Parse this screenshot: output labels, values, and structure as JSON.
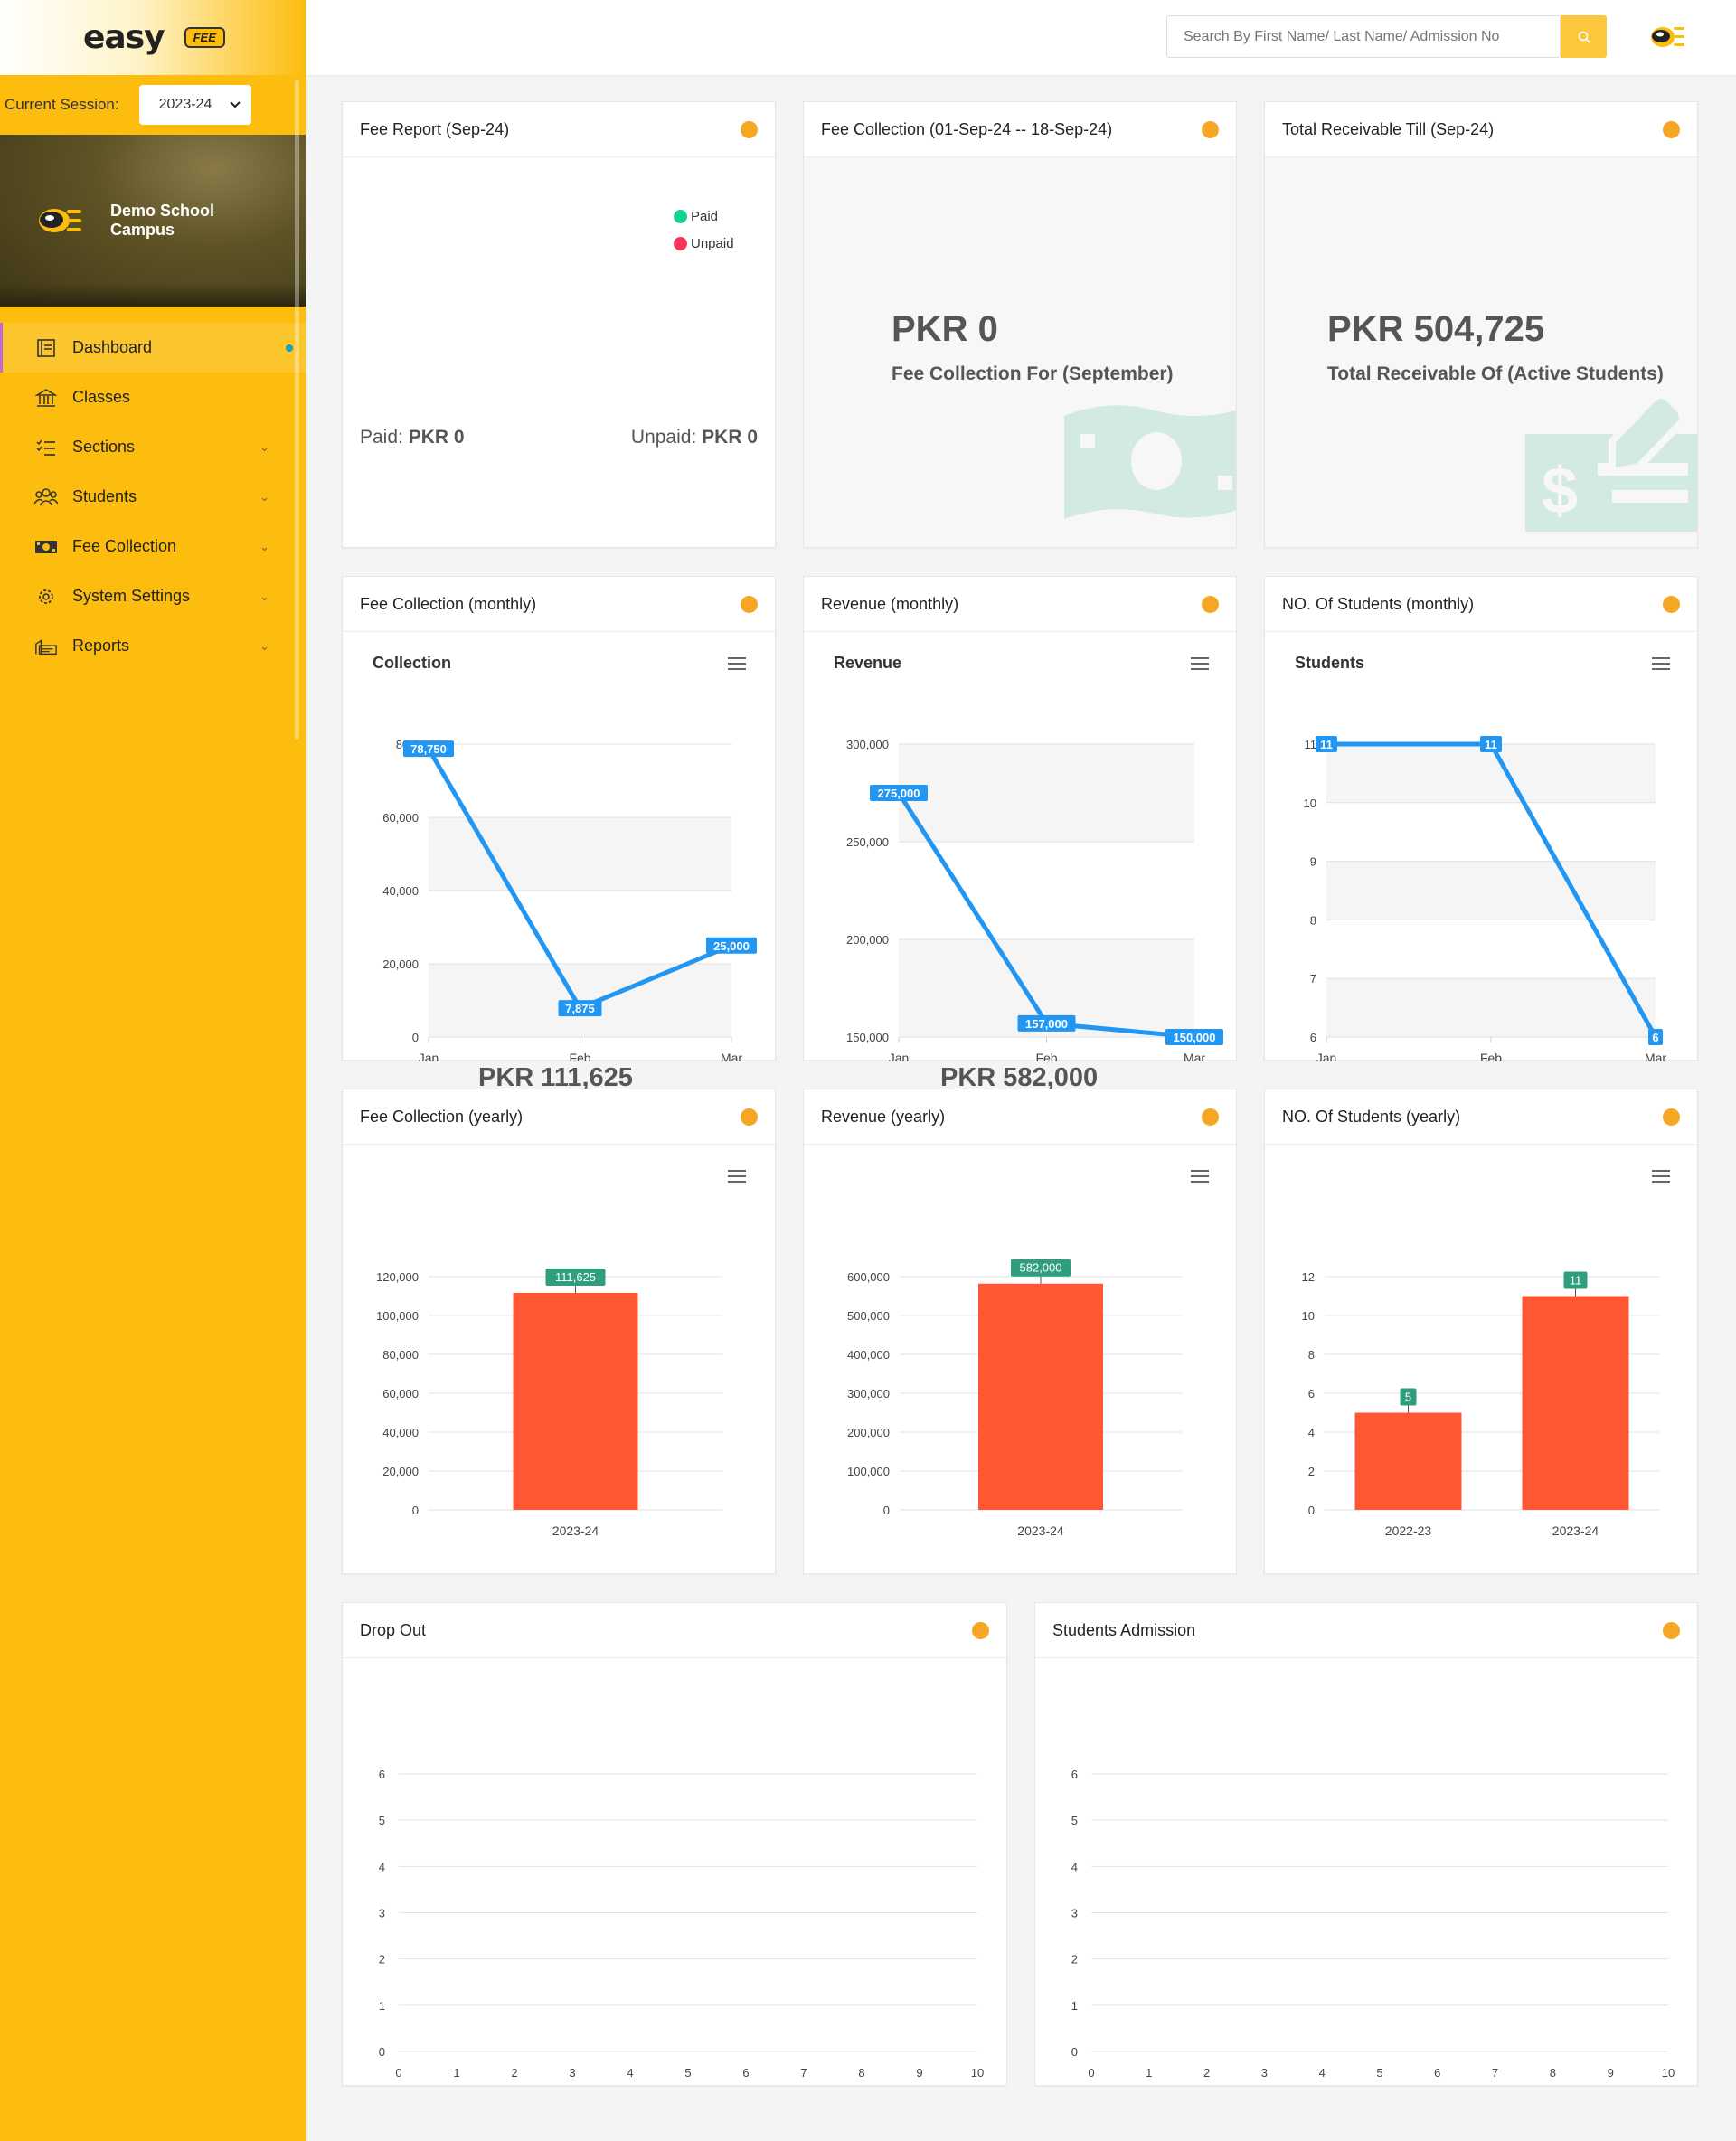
{
  "app": {
    "logo": "easy",
    "badge": "FEE"
  },
  "session": {
    "label": "Current Session:",
    "value": "2023-24"
  },
  "school": {
    "name": "Demo School Campus"
  },
  "nav": [
    {
      "label": "Dashboard",
      "icon": "dashboard-icon",
      "active": true
    },
    {
      "label": "Classes",
      "icon": "classes-icon"
    },
    {
      "label": "Sections",
      "icon": "sections-icon"
    },
    {
      "label": "Students",
      "icon": "students-icon"
    },
    {
      "label": "Fee Collection",
      "icon": "fee-collection-icon"
    },
    {
      "label": "System Settings",
      "icon": "settings-icon"
    },
    {
      "label": "Reports",
      "icon": "reports-icon"
    }
  ],
  "search": {
    "placeholder": "Search By First Name/ Last Name/ Admission No"
  },
  "cards": {
    "fee_report": {
      "title": "Fee Report (Sep-24)",
      "legend": [
        "Paid",
        "Unpaid"
      ],
      "paid_label": "Paid:",
      "paid_value": "PKR 0",
      "unpaid_label": "Unpaid:",
      "unpaid_value": "PKR 0"
    },
    "fee_collection": {
      "title": "Fee Collection (01-Sep-24 -- 18-Sep-24)",
      "value": "PKR 0",
      "subtitle": "Fee Collection For (September)"
    },
    "total_receivable": {
      "title": "Total Receivable Till (Sep-24)",
      "value": "PKR 504,725",
      "subtitle": "Total Receivable Of (Active Students)"
    },
    "fee_monthly": {
      "title": "Fee Collection (monthly)"
    },
    "revenue_monthly": {
      "title": "Revenue (monthly)"
    },
    "students_monthly": {
      "title": "NO. Of Students (monthly)"
    },
    "fee_yearly": {
      "title": "Fee Collection (yearly)",
      "total": "PKR 111,625"
    },
    "revenue_yearly": {
      "title": "Revenue (yearly)",
      "total": "PKR 582,000"
    },
    "students_yearly": {
      "title": "NO. Of Students (yearly)"
    },
    "drop_out": {
      "title": "Drop Out"
    },
    "admission": {
      "title": "Students Admission"
    }
  },
  "colors": {
    "sidebar": "#fdbd0f",
    "accent_dot": "#f5a623",
    "line": "#2196f3",
    "bar": "#ff5733",
    "bar_label": "#2e9e7e",
    "paid": "#12d18e",
    "unpaid": "#f5365c"
  },
  "chart_data": [
    {
      "type": "pie",
      "title": "",
      "legend": [
        "Paid",
        "Unpaid"
      ],
      "values": [
        0,
        0
      ]
    },
    {
      "type": "line",
      "title": "Collection",
      "categories": [
        "Jan",
        "Feb",
        "Mar"
      ],
      "values": [
        78750,
        7875,
        25000
      ],
      "value_labels": [
        "78,750",
        "7,875",
        "25,000"
      ],
      "ylim": [
        0,
        80000
      ],
      "yticks": [
        "0",
        "20,000",
        "40,000",
        "60,000",
        "80,0"
      ]
    },
    {
      "type": "line",
      "title": "Revenue",
      "categories": [
        "Jan",
        "Feb",
        "Mar"
      ],
      "values": [
        275000,
        157000,
        150000
      ],
      "value_labels": [
        "275,000",
        "157,000",
        "150,000"
      ],
      "ylim": [
        150000,
        300000
      ],
      "yticks": [
        "150,000",
        "200,000",
        "250,000",
        "300,000"
      ]
    },
    {
      "type": "line",
      "title": "Students",
      "categories": [
        "Jan",
        "Feb",
        "Mar"
      ],
      "values": [
        11,
        11,
        6
      ],
      "value_labels": [
        "11",
        "11",
        "6"
      ],
      "ylim": [
        6,
        11
      ],
      "yticks": [
        "6",
        "7",
        "8",
        "9",
        "10",
        "11"
      ]
    },
    {
      "type": "bar",
      "title": "",
      "categories": [
        "2023-24"
      ],
      "values": [
        111625
      ],
      "value_labels": [
        "111,625"
      ],
      "ylim": [
        0,
        120000
      ],
      "yticks": [
        "0",
        "20,000",
        "40,000",
        "60,000",
        "80,000",
        "100,000",
        "120,000"
      ]
    },
    {
      "type": "bar",
      "title": "",
      "categories": [
        "2023-24"
      ],
      "values": [
        582000
      ],
      "value_labels": [
        "582,000"
      ],
      "ylim": [
        0,
        600000
      ],
      "yticks": [
        "0",
        "100,000",
        "200,000",
        "300,000",
        "400,000",
        "500,000",
        "600,000"
      ]
    },
    {
      "type": "bar",
      "title": "",
      "categories": [
        "2022-23",
        "2023-24"
      ],
      "values": [
        5,
        11
      ],
      "value_labels": [
        "5",
        "11"
      ],
      "ylim": [
        0,
        12
      ],
      "yticks": [
        "0",
        "2",
        "4",
        "6",
        "8",
        "10",
        "12"
      ]
    },
    {
      "type": "line",
      "title": "",
      "x": [],
      "values": [],
      "xlim": [
        0,
        10
      ],
      "ylim": [
        0,
        6
      ],
      "xticks": [
        "0",
        "1",
        "2",
        "3",
        "4",
        "5",
        "6",
        "7",
        "8",
        "9",
        "10"
      ],
      "yticks": [
        "0",
        "1",
        "2",
        "3",
        "4",
        "5",
        "6"
      ]
    },
    {
      "type": "line",
      "title": "",
      "x": [],
      "values": [],
      "xlim": [
        0,
        10
      ],
      "ylim": [
        0,
        6
      ],
      "xticks": [
        "0",
        "1",
        "2",
        "3",
        "4",
        "5",
        "6",
        "7",
        "8",
        "9",
        "10"
      ],
      "yticks": [
        "0",
        "1",
        "2",
        "3",
        "4",
        "5",
        "6"
      ]
    }
  ]
}
